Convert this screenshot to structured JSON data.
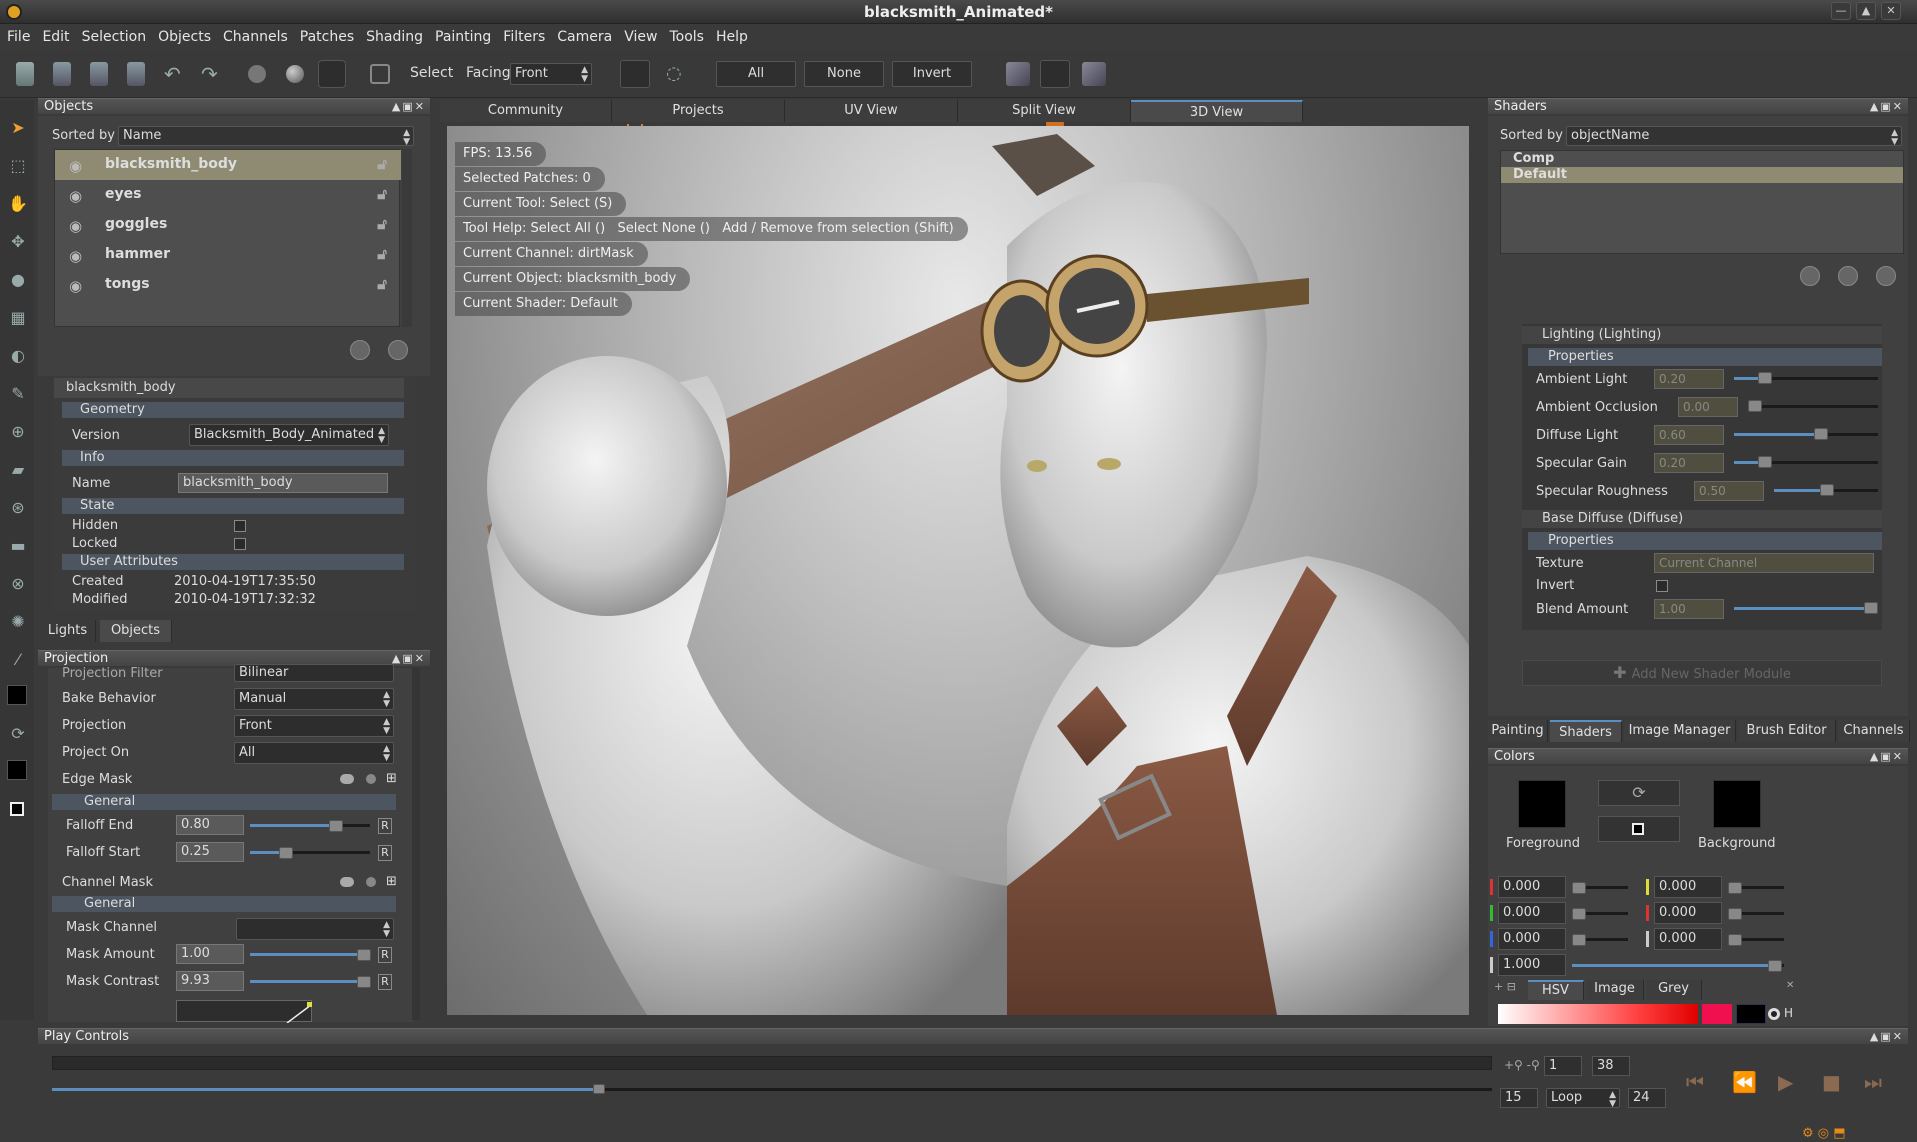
{
  "window": {
    "title": "blacksmith_Animated*"
  },
  "menubar": [
    "File",
    "Edit",
    "Selection",
    "Objects",
    "Channels",
    "Patches",
    "Shading",
    "Painting",
    "Filters",
    "Camera",
    "View",
    "Tools",
    "Help"
  ],
  "toolbar": {
    "select_label": "Select",
    "facing_label": "Facing",
    "facing_value": "Front",
    "all_label": "All",
    "none_label": "None",
    "invert_label": "Invert"
  },
  "objects_panel": {
    "title": "Objects",
    "sorted_by_label": "Sorted by",
    "sorted_by_value": "Name",
    "items": [
      "blacksmith_body",
      "eyes",
      "goggles",
      "hammer",
      "tongs"
    ],
    "selected_index": 0
  },
  "object_props": {
    "header": "blacksmith_body",
    "geometry_label": "Geometry",
    "version_label": "Version",
    "version_value": "Blacksmith_Body_Animated",
    "info_label": "Info",
    "name_label": "Name",
    "name_value": "blacksmith_body",
    "state_label": "State",
    "hidden_label": "Hidden",
    "locked_label": "Locked",
    "user_attr_label": "User Attributes",
    "created_label": "Created",
    "created_value": "2010-04-19T17:35:50",
    "modified_label": "Modified",
    "modified_value": "2010-04-19T17:32:32"
  },
  "left_tabs": [
    "Lights",
    "Objects"
  ],
  "projection_panel": {
    "title": "Projection",
    "filter_label": "Projection Filter",
    "filter_value": "Bilinear",
    "bake_label": "Bake Behavior",
    "bake_value": "Manual",
    "projection_label": "Projection",
    "projection_value": "Front",
    "project_on_label": "Project On",
    "project_on_value": "All",
    "edge_mask_label": "Edge Mask",
    "general_label": "General",
    "falloff_end_label": "Falloff End",
    "falloff_end_value": "0.80",
    "falloff_end_fraction": 0.72,
    "falloff_start_label": "Falloff Start",
    "falloff_start_value": "0.25",
    "falloff_start_fraction": 0.3,
    "channel_mask_label": "Channel Mask",
    "general2_label": "General",
    "mask_channel_label": "Mask Channel",
    "mask_amount_label": "Mask Amount",
    "mask_amount_value": "1.00",
    "mask_amount_fraction": 0.95,
    "mask_contrast_label": "Mask Contrast",
    "mask_contrast_value": "9.93",
    "mask_contrast_fraction": 0.95,
    "r_label": "R"
  },
  "view_tabs": [
    "Community",
    "Projects",
    "UV View",
    "Split View",
    "3D View"
  ],
  "active_view_tab": 4,
  "hud": [
    "FPS: 13.56",
    "Selected Patches: 0",
    "Current Tool: Select (S)",
    "Tool Help: Select All ()   Select None ()   Add / Remove from selection (Shift)",
    "Current Channel: dirtMask",
    "Current Object: blacksmith_body",
    "Current Shader: Default"
  ],
  "shaders_panel": {
    "title": "Shaders",
    "sorted_by_label": "Sorted by",
    "sorted_by_value": "objectName",
    "items": [
      "Comp",
      "Default"
    ],
    "selected_index": 1,
    "lighting_label": "Lighting (Lighting)",
    "properties_label": "Properties",
    "ambient_light_label": "Ambient Light",
    "ambient_light_value": "0.20",
    "ambient_occlusion_label": "Ambient Occlusion",
    "ambient_occlusion_value": "0.00",
    "diffuse_light_label": "Diffuse Light",
    "diffuse_light_value": "0.60",
    "specular_gain_label": "Specular Gain",
    "specular_gain_value": "0.20",
    "specular_roughness_label": "Specular Roughness",
    "specular_roughness_value": "0.50",
    "base_diffuse_label": "Base Diffuse (Diffuse)",
    "properties2_label": "Properties",
    "texture_label": "Texture",
    "texture_value": "Current Channel",
    "invert_label": "Invert",
    "blend_amount_label": "Blend Amount",
    "blend_amount_value": "1.00",
    "add_module_label": "Add New Shader Module"
  },
  "right_tabs": [
    "Painting",
    "Shaders",
    "Image Manager",
    "Brush Editor",
    "Channels"
  ],
  "active_right_tab": 1,
  "colors_panel": {
    "title": "Colors",
    "foreground_label": "Foreground",
    "background_label": "Background",
    "values_left": [
      "0.000",
      "0.000",
      "0.000"
    ],
    "values_right": [
      "0.000",
      "0.000",
      "0.000"
    ],
    "alpha_value": "1.000",
    "tabs": [
      "HSV",
      "Image",
      "Grey"
    ],
    "h_label": "H"
  },
  "play_controls": {
    "title": "Play Controls",
    "frame_start": "1",
    "frame_end": "38",
    "fps_value": "15",
    "loop_value": "Loop",
    "end_value": "24",
    "progress_fraction": 0.38
  },
  "colors": {
    "accent": "#5a8fc0",
    "selected_row": "#8f8a72",
    "orange": "#e88a1a"
  }
}
